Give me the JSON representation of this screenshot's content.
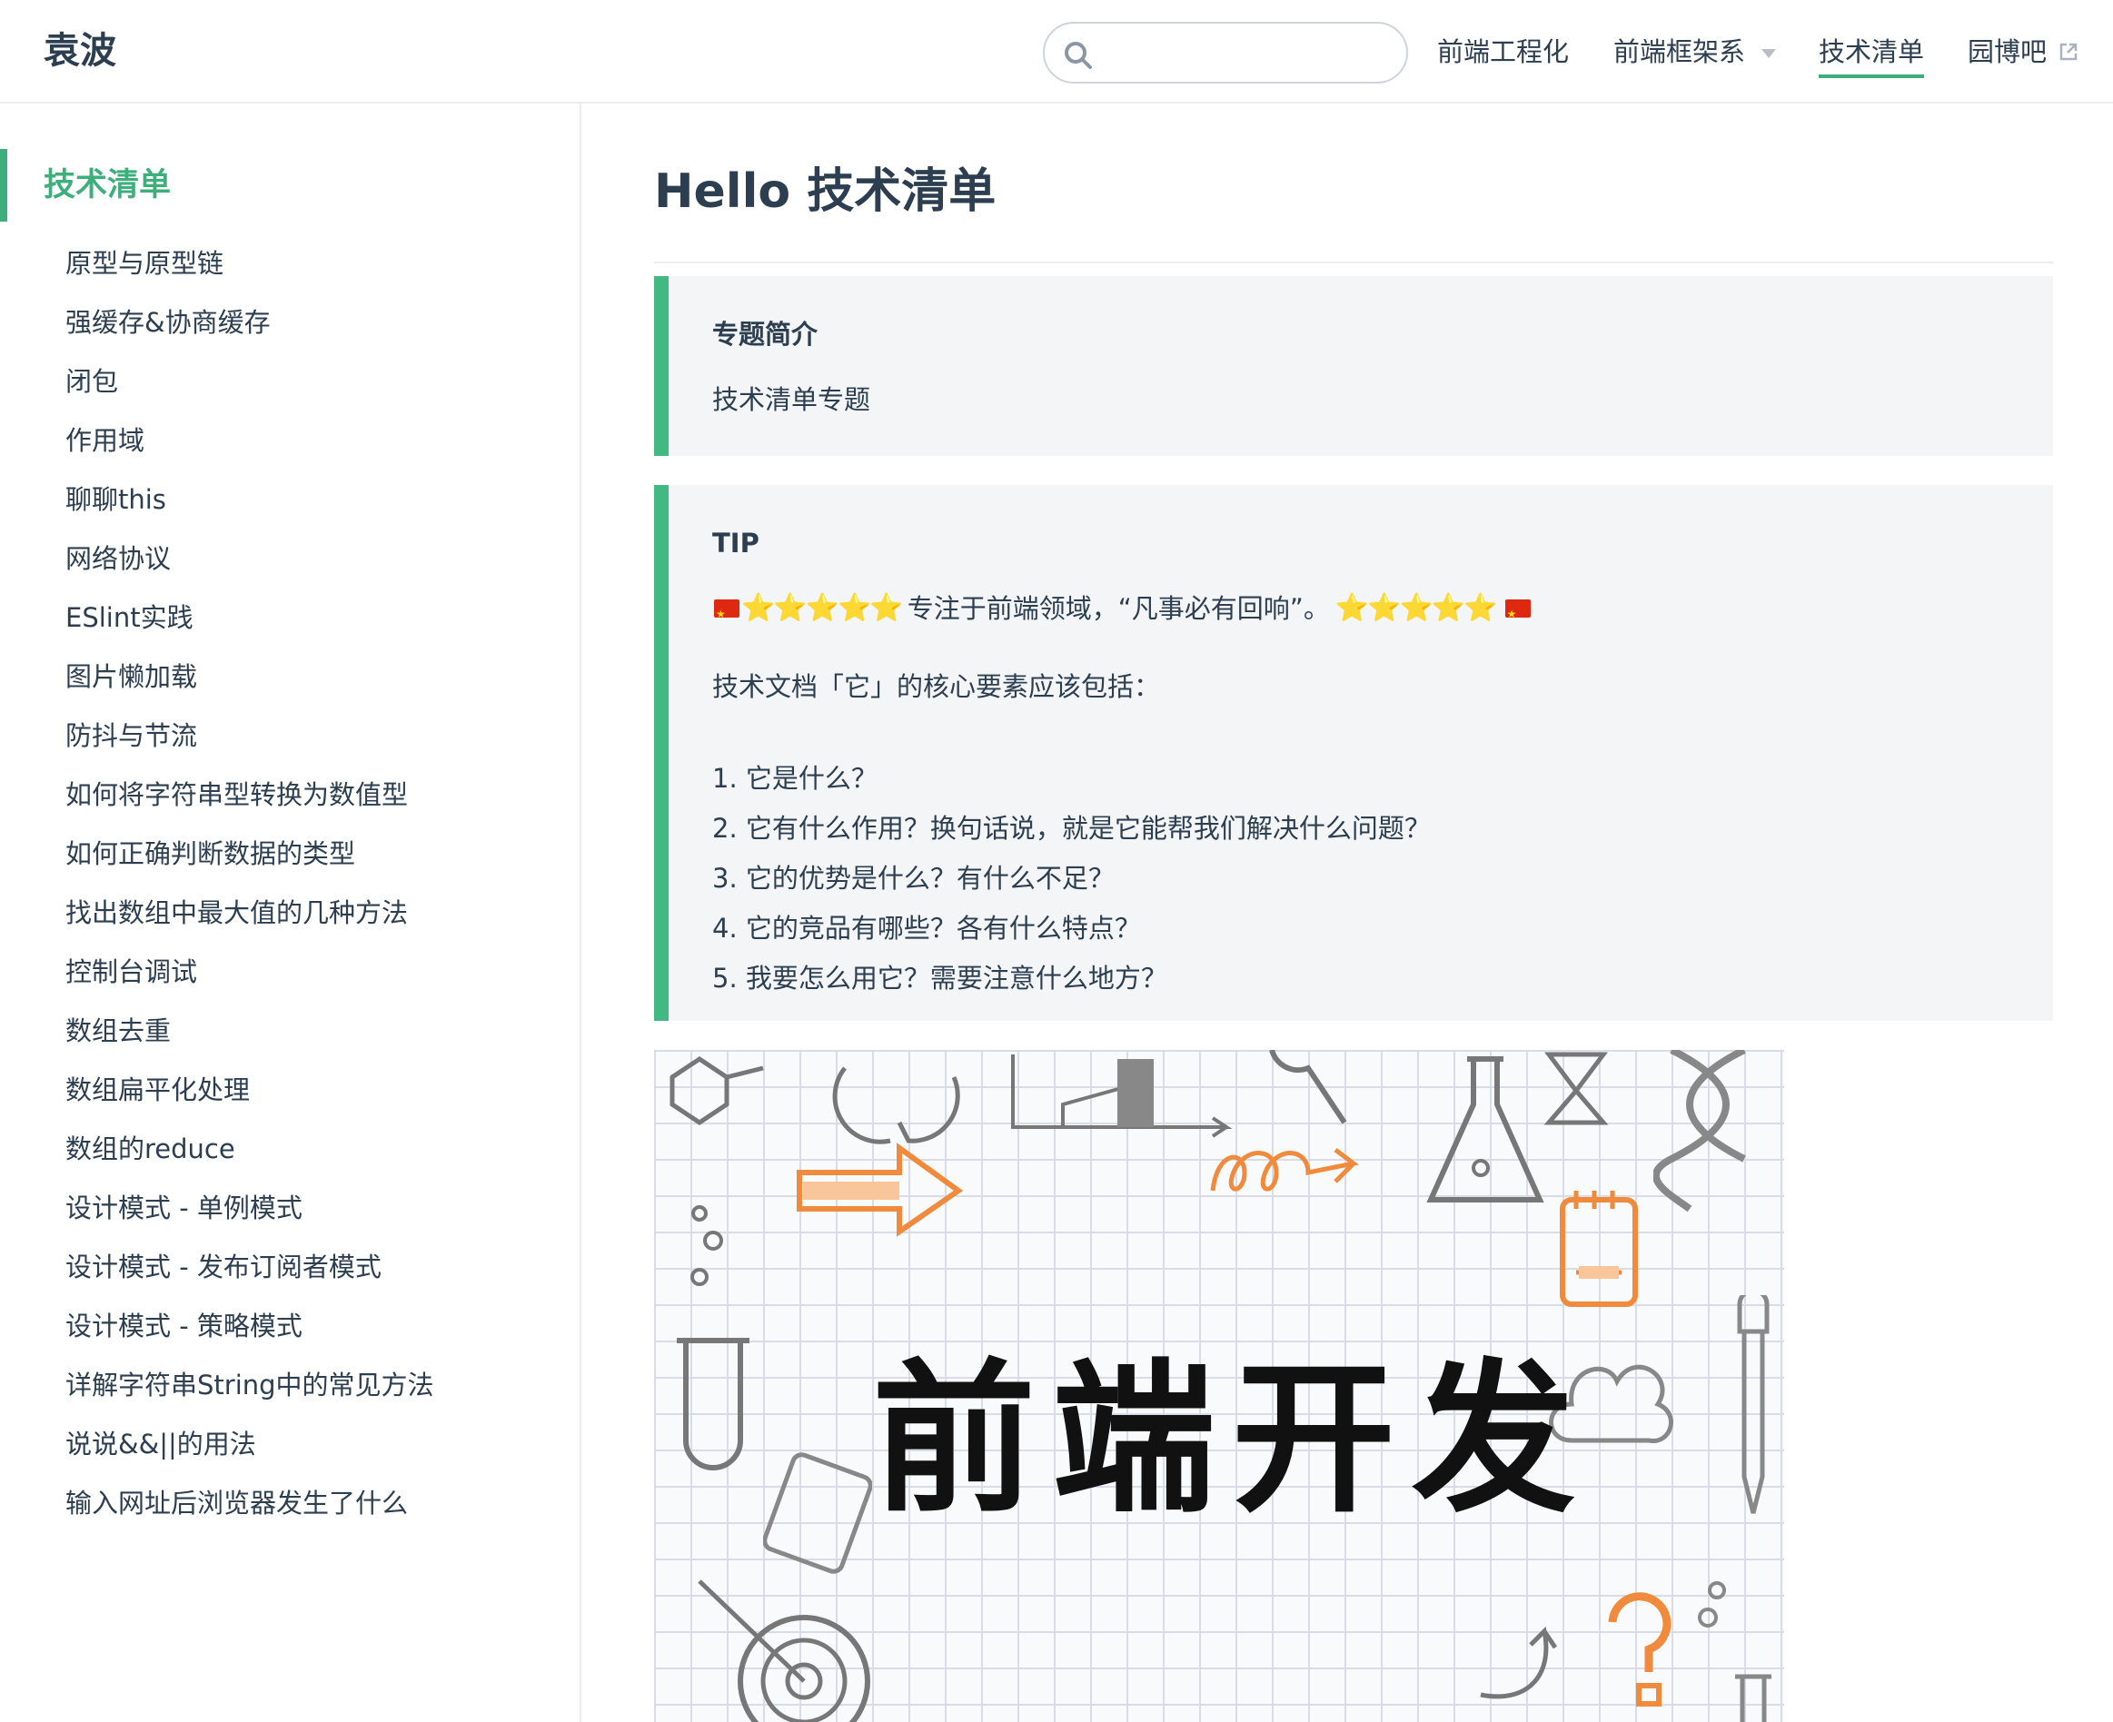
{
  "header": {
    "site_title": "袁波",
    "search": {
      "value": "",
      "placeholder": ""
    },
    "nav": [
      {
        "label": "前端工程化"
      },
      {
        "label": "前端框架系",
        "has_dropdown": true
      },
      {
        "label": "技术清单",
        "active": true
      },
      {
        "label": "园博吧",
        "external": true
      }
    ]
  },
  "sidebar": {
    "heading": "技术清单",
    "items": [
      "原型与原型链",
      "强缓存&协商缓存",
      "闭包",
      "作用域",
      "聊聊this",
      "网络协议",
      "ESlint实践",
      "图片懒加载",
      "防抖与节流",
      "如何将字符串型转换为数值型",
      "如何正确判断数据的类型",
      "找出数组中最大值的几种方法",
      "控制台调试",
      "数组去重",
      "数组扁平化处理",
      "数组的reduce",
      "设计模式 - 单例模式",
      "设计模式 - 发布订阅者模式",
      "设计模式 - 策略模式",
      "详解字符串String中的常见方法",
      "说说&&||的用法",
      "输入网址后浏览器发生了什么"
    ]
  },
  "main": {
    "title": "Hello 技术清单",
    "intro_block": {
      "title": "专题简介",
      "text": "技术清单专题"
    },
    "tip_block": {
      "title": "TIP",
      "motto_stars": "⭐⭐⭐⭐⭐",
      "motto_text": "专注于前端领域，“凡事必有回响”。",
      "lead": "技术文档「它」的核心要素应该包括：",
      "list": [
        "1. 它是什么？",
        "2. 它有什么作用？换句话说，就是它能帮我们解决什么问题？",
        "3. 它的优势是什么？有什么不足？",
        "4. 它的竞品有哪些？各有什么特点？",
        "5. 我要怎么用它？需要注意什么地方？"
      ]
    },
    "banner": {
      "text": "前端开发"
    }
  },
  "colors": {
    "accent": "#3eaf7c",
    "block_border": "#42b983",
    "block_bg": "#f3f5f7",
    "text": "#2c3e50",
    "doodle_orange": "#f08a3c"
  },
  "icons": [
    "search-icon",
    "chevron-down-icon",
    "external-link-icon",
    "flag-cn-icon",
    "star-icon"
  ]
}
